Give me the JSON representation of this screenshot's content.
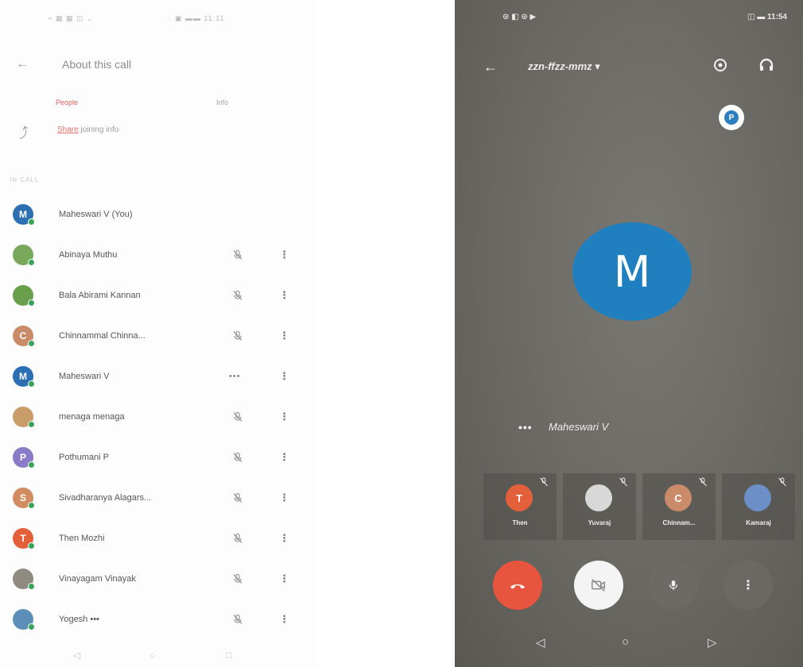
{
  "left_panel": {
    "status_left": "⌁ ▦ ▦ ◫ ⌄",
    "status_right": "◌ ▣ ▬▬ 11:11",
    "title": "About this call",
    "tabs": {
      "people": "People",
      "info": "Info"
    },
    "share_highlight": "Share",
    "share_text": " joining info",
    "section_label": "IN CALL",
    "participants": [
      {
        "initial": "M",
        "name": "Maheswari V (You)",
        "color": "#2d6fb3",
        "state": "none"
      },
      {
        "initial": "",
        "name": "Abinaya Muthu",
        "color": "#79a85b",
        "state": "muted"
      },
      {
        "initial": "",
        "name": "Bala Abirami Kannan",
        "color": "#6aa04c",
        "state": "muted"
      },
      {
        "initial": "C",
        "name": "Chinnammal Chinna...",
        "color": "#c98b6a",
        "state": "muted"
      },
      {
        "initial": "M",
        "name": "Maheswari V",
        "color": "#2d6fb3",
        "state": "speaking"
      },
      {
        "initial": "",
        "name": "menaga menaga",
        "color": "#c99d6a",
        "state": "muted"
      },
      {
        "initial": "P",
        "name": "Pothumani P",
        "color": "#8a7bc7",
        "state": "muted"
      },
      {
        "initial": "S",
        "name": "Sivadharanya Alagars...",
        "color": "#d28c62",
        "state": "muted"
      },
      {
        "initial": "T",
        "name": "Then Mozhi",
        "color": "#e4603b",
        "state": "muted"
      },
      {
        "initial": "",
        "name": "Vinayagam Vinayak",
        "color": "#8f8a80",
        "state": "muted"
      },
      {
        "initial": "",
        "name": "Yogesh •••",
        "color": "#5b8fb8",
        "state": "muted"
      }
    ],
    "speaking_dots": "•••",
    "more_icon": "⋮",
    "nav": {
      "back": "◁",
      "home": "○",
      "recent": "□"
    }
  },
  "phone": {
    "status_left": "⊙ ◧ ⊙ ▶",
    "status_right": "◫ ▬ 11:54",
    "meeting_code": "zzn-ffzz-mmz ▾",
    "pin_initial": "P",
    "main_initial": "M",
    "speaking_dots": "•••",
    "speaker_name": "Maheswari V",
    "tiles": [
      {
        "initial": "T",
        "name": "Then",
        "color": "#e4603b"
      },
      {
        "initial": "",
        "name": "Yuvaraj",
        "color": "#d8d8d8"
      },
      {
        "initial": "C",
        "name": "Chinnam...",
        "color": "#c98b6a"
      },
      {
        "initial": "",
        "name": "Kamaraj",
        "color": "#6b8fc6"
      }
    ],
    "more_icon": "⋮",
    "nav": {
      "back": "◁",
      "home": "○",
      "recent": "▷"
    }
  }
}
